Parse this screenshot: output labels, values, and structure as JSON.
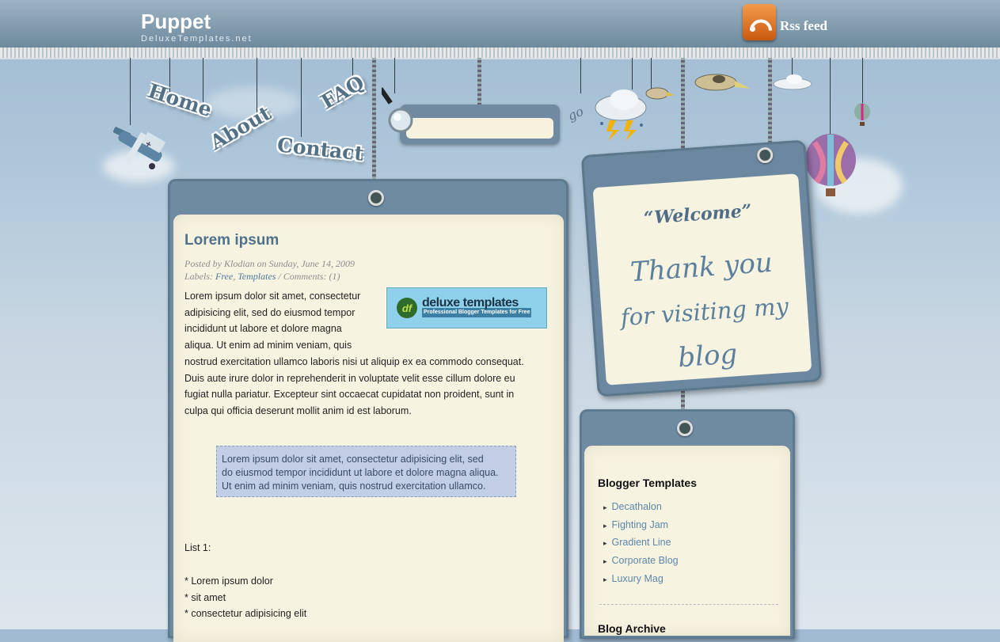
{
  "header": {
    "title": "Puppet",
    "subtitle": "DeluxeTemplates.net",
    "rss_label": "Rss feed"
  },
  "nav": {
    "items": [
      {
        "label": "Home"
      },
      {
        "label": "About"
      },
      {
        "label": "Contact"
      },
      {
        "label": "FAQ"
      }
    ]
  },
  "search": {
    "placeholder": "",
    "go_label": "go"
  },
  "post": {
    "title": "Lorem ipsum",
    "meta_posted": "Posted by Klodian on Sunday, June 14, 2009",
    "meta_labels_prefix": "Labels:",
    "labels": [
      "Free",
      "Templates"
    ],
    "comments": "/ Comments: (1)",
    "banner": {
      "logo": "df",
      "name": "deluxe templates",
      "tagline": "Professional Blogger Templates for Free"
    },
    "body_lines": [
      "Lorem ipsum dolor sit amet, consectetur",
      "adipisicing elit, sed do eiusmod tempor",
      "incididunt ut labore et dolore magna",
      "aliqua. Ut enim ad minim veniam, quis",
      "nostrud exercitation ullamco laboris nisi ut aliquip ex ea commodo consequat.",
      "Duis aute irure dolor in reprehenderit in voluptate velit esse cillum dolore eu",
      "fugiat nulla pariatur. Excepteur sint occaecat cupidatat non proident, sunt in",
      "culpa qui officia deserunt mollit anim id est laborum."
    ],
    "quote_lines": [
      "Lorem ipsum dolor sit amet, consectetur adipisicing elit, sed",
      "do eiusmod tempor incididunt ut labore et dolore magna aliqua.",
      "Ut enim ad minim veniam, quis nostrud exercitation ullamco."
    ],
    "list_title": "List 1:",
    "list_items": [
      "* Lorem ipsum dolor",
      "* sit amet",
      "* consectetur adipisicing elit"
    ]
  },
  "welcome": {
    "heading": "“Welcome”",
    "message_lines": [
      "Thank you",
      "for visiting my",
      "blog"
    ]
  },
  "sidebar": {
    "widget_title": "Blogger Templates",
    "items": [
      {
        "label": "Decathalon"
      },
      {
        "label": "Fighting Jam"
      },
      {
        "label": "Gradient Line"
      },
      {
        "label": "Corporate Blog"
      },
      {
        "label": "Luxury Mag"
      }
    ],
    "archive_title": "Blog Archive"
  },
  "icons": {
    "rss": "rss-icon",
    "search": "magnifier-icon",
    "plane": "biplane-icon",
    "storm": "storm-cloud-icon",
    "bird": "bird-icon",
    "balloon": "hot-air-balloon-icon"
  },
  "colors": {
    "accent": "#4f7189",
    "link": "#5c87a8",
    "panel": "#6e8ba2",
    "paper": "#f7f3e1",
    "quote_bg": "#c2cee6",
    "rss": "#e27a2a"
  }
}
